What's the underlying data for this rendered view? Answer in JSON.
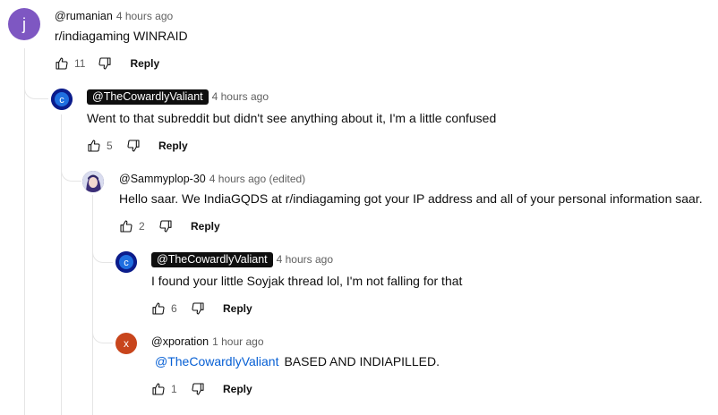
{
  "comments": [
    {
      "author": "@rumanian",
      "time": "4 hours ago",
      "text": "r/indiagaming WINRAID",
      "likes": "11",
      "reply": "Reply",
      "avatar_letter": "j",
      "avatar_color": "#7e57c2"
    },
    {
      "author": "@TheCowardlyValiant",
      "time": "4 hours ago",
      "text": "Went to that subreddit but didn't see anything about it, I'm a little confused",
      "likes": "5",
      "reply": "Reply"
    },
    {
      "author": "@Sammyplop-30",
      "time": "4 hours ago (edited)",
      "text": "Hello saar. We IndiaGQDS at r/indiagaming got your IP address and all of your personal information saar.",
      "likes": "2",
      "reply": "Reply"
    },
    {
      "author": "@TheCowardlyValiant",
      "time": "4 hours ago",
      "text": "I found your little Soyjak thread lol, I'm not falling for that",
      "likes": "6",
      "reply": "Reply"
    },
    {
      "author": "@xporation",
      "time": "1 hour ago",
      "mention": "@TheCowardlyValiant",
      "text": "BASED AND INDIAPILLED.",
      "likes": "1",
      "reply": "Reply",
      "avatar_letter": "x",
      "avatar_color": "#c8451c"
    }
  ],
  "icons": {
    "like": "thumbs-up-icon",
    "dislike": "thumbs-down-icon"
  },
  "colors": {
    "link": "#065fd4",
    "chip": "#0f0f0f",
    "meta": "#606060"
  }
}
